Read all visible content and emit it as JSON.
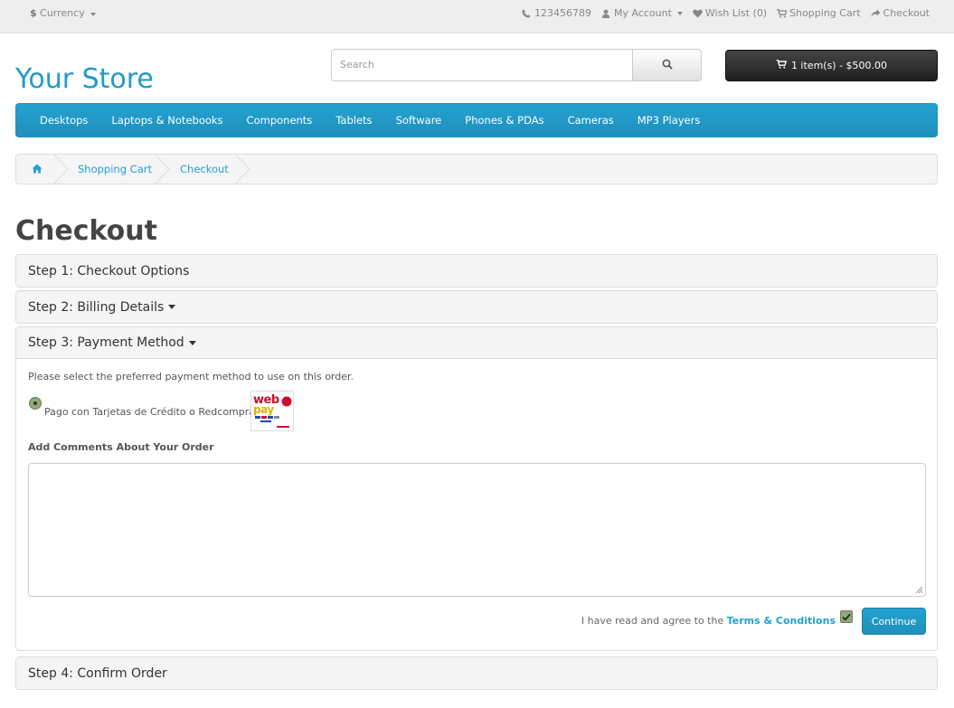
{
  "topbar": {
    "currency_symbol": "$",
    "currency_label": "Currency",
    "phone": "123456789",
    "my_account": "My Account",
    "wish_list": "Wish List (0)",
    "shopping_cart": "Shopping Cart",
    "checkout": "Checkout"
  },
  "header": {
    "logo": "Your Store",
    "search_placeholder": "Search",
    "cart_summary": "1 item(s) - $500.00"
  },
  "menu": {
    "items": [
      "Desktops",
      "Laptops & Notebooks",
      "Components",
      "Tablets",
      "Software",
      "Phones & PDAs",
      "Cameras",
      "MP3 Players"
    ]
  },
  "breadcrumb": {
    "items": [
      "Shopping Cart",
      "Checkout"
    ]
  },
  "page": {
    "title": "Checkout"
  },
  "steps": {
    "step1": "Step 1: Checkout Options",
    "step2": "Step 2: Billing Details",
    "step3": "Step 3: Payment Method",
    "step4": "Step 4: Confirm Order"
  },
  "payment": {
    "instruction": "Please select the preferred payment method to use on this order.",
    "method_label": "Pago con Tarjetas de Crédito o Redcompra",
    "method_selected": true,
    "logo_text": "webpay",
    "comments_label": "Add Comments About Your Order",
    "comments_value": "",
    "agree_text": "I have read and agree to the",
    "terms_link": "Terms & Conditions",
    "terms_checked": true,
    "continue_label": "Continue"
  },
  "colors": {
    "accent": "#229ac8",
    "cart_button": "#2a2a2a",
    "checked": "#8fa87a"
  }
}
